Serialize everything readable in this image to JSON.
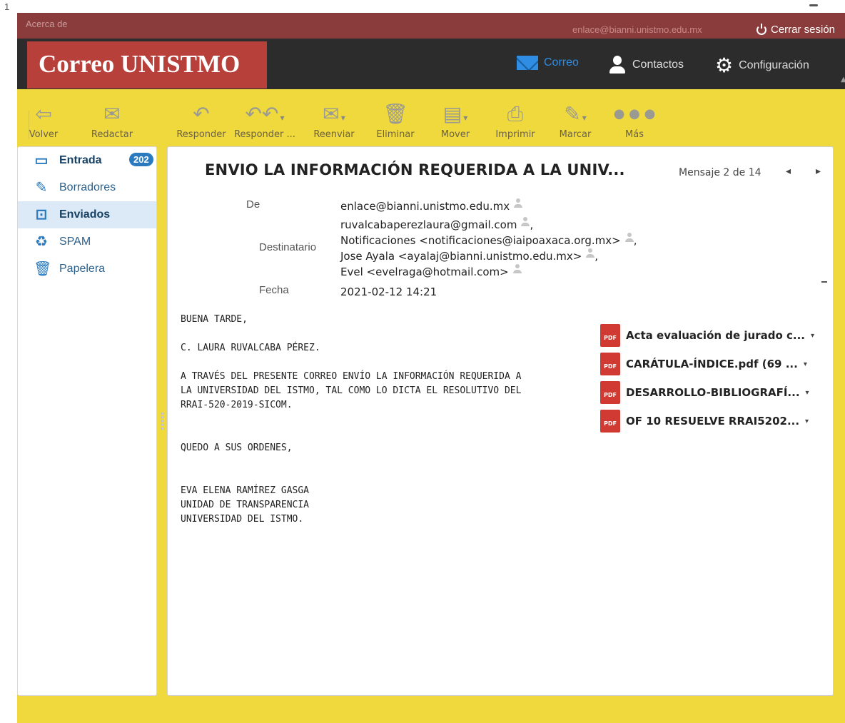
{
  "page_mark": "1",
  "topbar": {
    "about": "Acerca de",
    "user_email": "enlace@bianni.unistmo.edu.mx",
    "logout": "Cerrar sesión"
  },
  "header": {
    "logo": "Correo UNISTMO",
    "nav": [
      {
        "label": "Correo",
        "icon": "mail-icon"
      },
      {
        "label": "Contactos",
        "icon": "person-icon"
      },
      {
        "label": "Configuración",
        "icon": "gear-icon"
      }
    ]
  },
  "toolbar": [
    {
      "label": "Volver",
      "icon": "back-arrow-icon"
    },
    {
      "label": "Redactar",
      "icon": "compose-icon"
    },
    {
      "label": "Responder",
      "icon": "reply-icon"
    },
    {
      "label": "Responder ...",
      "icon": "reply-all-icon"
    },
    {
      "label": "Reenviar",
      "icon": "forward-icon"
    },
    {
      "label": "Eliminar",
      "icon": "trash-icon"
    },
    {
      "label": "Mover",
      "icon": "move-folder-icon"
    },
    {
      "label": "Imprimir",
      "icon": "print-icon"
    },
    {
      "label": "Marcar",
      "icon": "mark-pencil-icon"
    },
    {
      "label": "Más",
      "icon": "more-dots-icon"
    }
  ],
  "sidebar": {
    "folders": [
      {
        "label": "Entrada",
        "badge": "202",
        "icon": "inbox-icon"
      },
      {
        "label": "Borradores",
        "icon": "pencil-icon"
      },
      {
        "label": "Enviados",
        "icon": "sent-icon"
      },
      {
        "label": "SPAM",
        "icon": "spam-icon"
      },
      {
        "label": "Papelera",
        "icon": "trash-icon"
      }
    ]
  },
  "message": {
    "subject": "ENVIO LA INFORMACIÓN REQUERIDA A LA UNIV...",
    "counter": "Mensaje 2 de 14",
    "from_label": "De",
    "from": "enlace@bianni.unistmo.edu.mx",
    "to_label": "Destinatario",
    "to": [
      "ruvalcabaperezlaura@gmail.com",
      "Notificaciones <notificaciones@iaipoaxaca.org.mx>",
      "Jose Ayala <ayalaj@bianni.unistmo.edu.mx>",
      "Evel <evelraga@hotmail.com>"
    ],
    "date_label": "Fecha",
    "date": "2021-02-12 14:21",
    "body": "BUENA TARDE,\n\nC. LAURA RUVALCABA PÉREZ.\n\nA TRAVÉS DEL PRESENTE CORREO ENVÍO LA INFORMACIÓN REQUERIDA A\nLA UNIVERSIDAD DEL ISTMO, TAL COMO LO DICTA EL RESOLUTIVO DEL\nRRAI-520-2019-SICOM.\n\n\nQUEDO A SUS ORDENES,\n\n\nEVA ELENA RAMÍREZ GASGA\nUNIDAD DE TRANSPARENCIA\nUNIVERSIDAD DEL ISTMO.",
    "attachments": [
      {
        "name": "Acta evaluación de jurado c..."
      },
      {
        "name": "CARÁTULA-ÍNDICE.pdf (69 ..."
      },
      {
        "name": "DESARROLLO-BIBLIOGRAFÍ..."
      },
      {
        "name": "OF 10 RESUELVE RRAI5202..."
      }
    ]
  },
  "colors": {
    "frame": "#f0d93c",
    "topbar": "#8a3b3b",
    "header": "#2c2c2c",
    "logo": "#b8403a",
    "accent": "#2a7abf",
    "pdf": "#d03a32"
  }
}
